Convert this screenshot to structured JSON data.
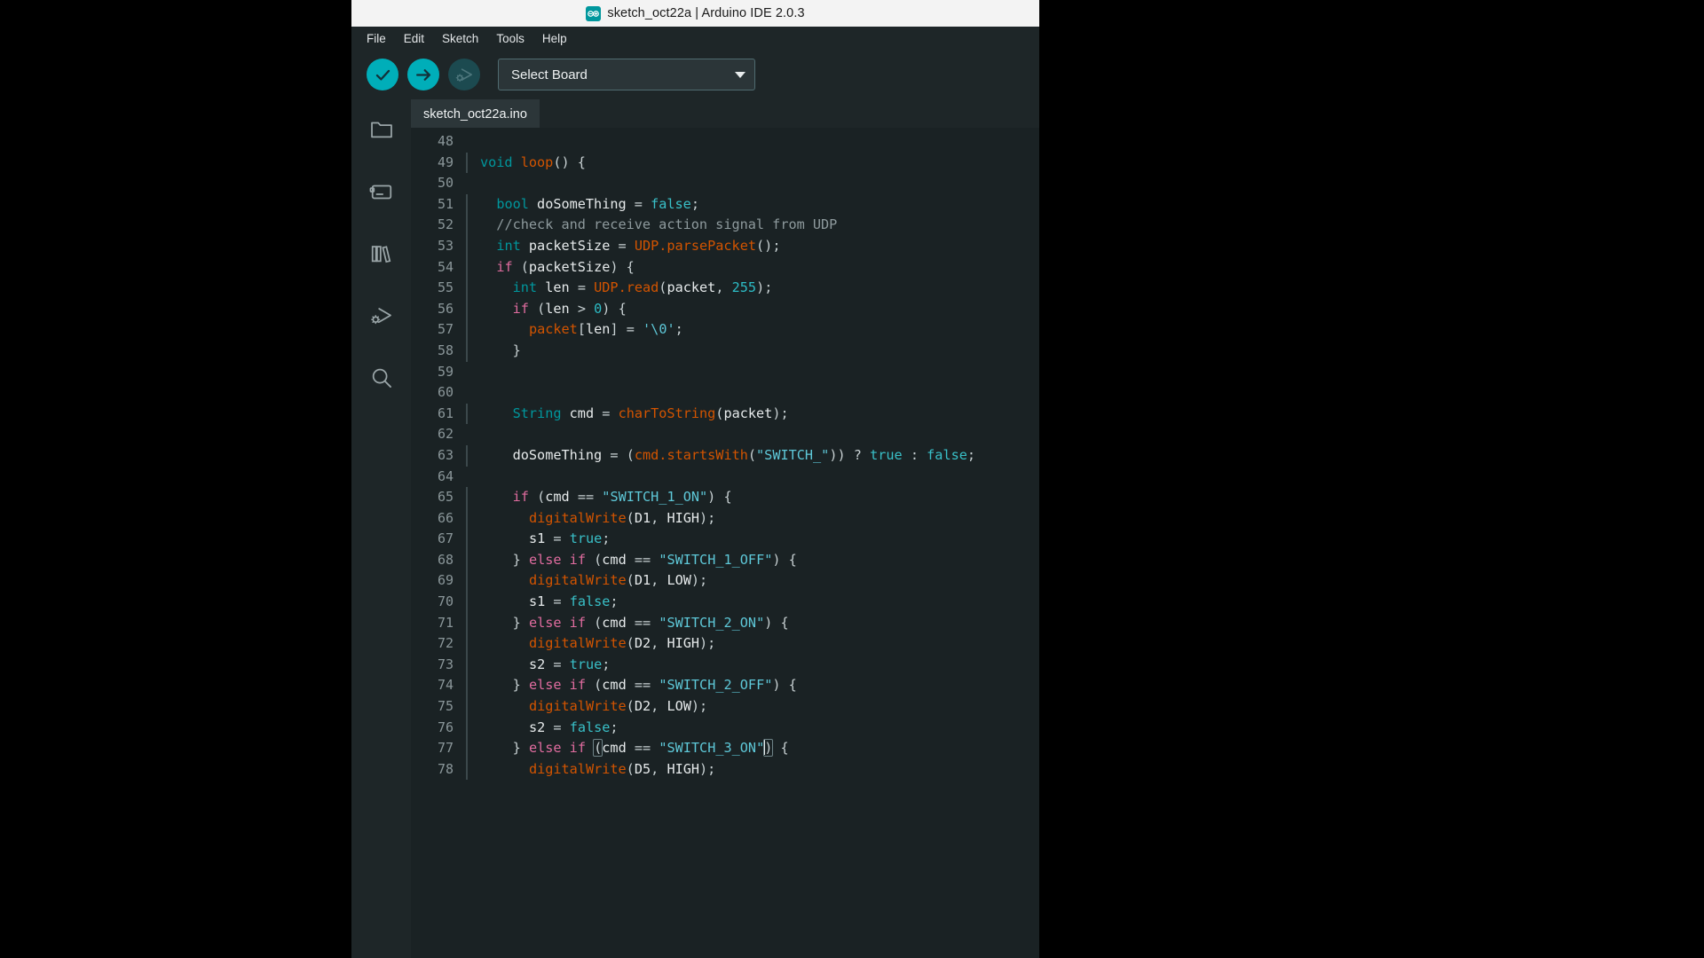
{
  "window": {
    "title": "sketch_oct22a | Arduino IDE 2.0.3",
    "logo_name": "arduino-logo-icon"
  },
  "menubar": {
    "items": [
      {
        "label": "File"
      },
      {
        "label": "Edit"
      },
      {
        "label": "Sketch"
      },
      {
        "label": "Tools"
      },
      {
        "label": "Help"
      }
    ]
  },
  "toolbar": {
    "verify_name": "verify-button",
    "upload_name": "upload-button",
    "debug_name": "debug-button",
    "board_select_label": "Select Board"
  },
  "activitybar": {
    "items": [
      {
        "name": "sketchbook-icon",
        "label": "Sketchbook"
      },
      {
        "name": "boards-manager-icon",
        "label": "Boards Manager"
      },
      {
        "name": "library-manager-icon",
        "label": "Library Manager"
      },
      {
        "name": "debug-icon",
        "label": "Debug"
      },
      {
        "name": "search-icon",
        "label": "Search"
      }
    ]
  },
  "editor": {
    "tabs": [
      {
        "label": "sketch_oct22a.ino",
        "active": true
      }
    ],
    "first_line_number": 48,
    "colors": {
      "background": "#1a2224",
      "keyword": "#00979d",
      "control": "#e06c9f",
      "function": "#d35400",
      "string": "#5ec8d8",
      "number": "#2dbdc6",
      "comment": "#8e9a9d",
      "text": "#e6eaeb",
      "accent": "#00aeb9"
    },
    "lines": [
      {
        "n": 48,
        "text": ""
      },
      {
        "n": 49,
        "text": "void loop() {"
      },
      {
        "n": 50,
        "text": ""
      },
      {
        "n": 51,
        "text": "  bool doSomeThing = false;"
      },
      {
        "n": 52,
        "text": "  //check and receive action signal from UDP"
      },
      {
        "n": 53,
        "text": "  int packetSize = UDP.parsePacket();"
      },
      {
        "n": 54,
        "text": "  if (packetSize) {"
      },
      {
        "n": 55,
        "text": "    int len = UDP.read(packet, 255);"
      },
      {
        "n": 56,
        "text": "    if (len > 0) {"
      },
      {
        "n": 57,
        "text": "      packet[len] = '\\0';"
      },
      {
        "n": 58,
        "text": "    }"
      },
      {
        "n": 59,
        "text": ""
      },
      {
        "n": 60,
        "text": ""
      },
      {
        "n": 61,
        "text": "    String cmd = charToString(packet);"
      },
      {
        "n": 62,
        "text": ""
      },
      {
        "n": 63,
        "text": "    doSomeThing = (cmd.startsWith(\"SWITCH_\")) ? true : false;"
      },
      {
        "n": 64,
        "text": ""
      },
      {
        "n": 65,
        "text": "    if (cmd == \"SWITCH_1_ON\") {"
      },
      {
        "n": 66,
        "text": "      digitalWrite(D1, HIGH);"
      },
      {
        "n": 67,
        "text": "      s1 = true;"
      },
      {
        "n": 68,
        "text": "    } else if (cmd == \"SWITCH_1_OFF\") {"
      },
      {
        "n": 69,
        "text": "      digitalWrite(D1, LOW);"
      },
      {
        "n": 70,
        "text": "      s1 = false;"
      },
      {
        "n": 71,
        "text": "    } else if (cmd == \"SWITCH_2_ON\") {"
      },
      {
        "n": 72,
        "text": "      digitalWrite(D2, HIGH);"
      },
      {
        "n": 73,
        "text": "      s2 = true;"
      },
      {
        "n": 74,
        "text": "    } else if (cmd == \"SWITCH_2_OFF\") {"
      },
      {
        "n": 75,
        "text": "      digitalWrite(D2, LOW);"
      },
      {
        "n": 76,
        "text": "      s2 = false;"
      },
      {
        "n": 77,
        "text": "    } else if (cmd == \"SWITCH_3_ON\") {"
      },
      {
        "n": 78,
        "text": "      digitalWrite(D5, HIGH);"
      }
    ]
  }
}
